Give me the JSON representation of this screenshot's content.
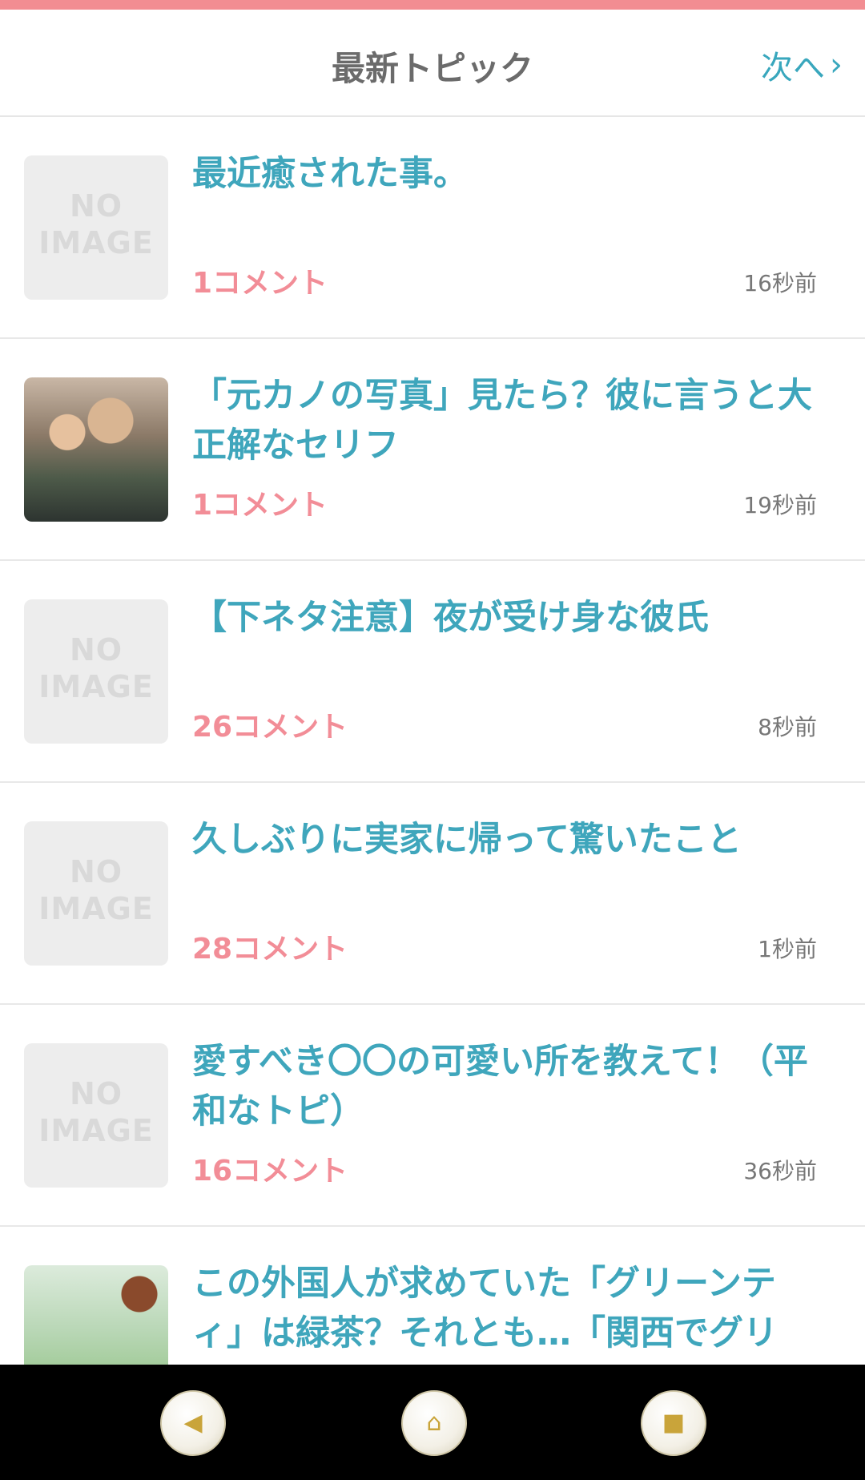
{
  "header": {
    "title": "最新トピック",
    "next_label": "次へ",
    "next_icon": "chevron-right-icon"
  },
  "topics": [
    {
      "title": "最近癒された事。",
      "comments": "1コメント",
      "time": "16秒前",
      "thumb": "NO IMAGE"
    },
    {
      "title": "「元カノの写真」見たら？彼に言うと大正解なセリフ",
      "comments": "1コメント",
      "time": "19秒前",
      "thumb": ""
    },
    {
      "title": "【下ネタ注意】夜が受け身な彼氏",
      "comments": "26コメント",
      "time": "8秒前",
      "thumb": "NO IMAGE"
    },
    {
      "title": "久しぶりに実家に帰って驚いたこと",
      "comments": "28コメント",
      "time": "1秒前",
      "thumb": "NO IMAGE"
    },
    {
      "title": "愛すべき〇〇の可愛い所を教えて！（平和なトピ）",
      "comments": "16コメント",
      "time": "36秒前",
      "thumb": "NO IMAGE"
    },
    {
      "title": "この外国人が求めていた「グリーンティ」は緑茶？それとも…「関西でグリ",
      "comments": "",
      "time": "",
      "thumb": ""
    }
  ],
  "navbar": {
    "back_icon": "back-triangle-icon",
    "home_icon": "home-icon",
    "recents_icon": "recents-square-icon"
  },
  "colors": {
    "accent": "#f28d92",
    "title": "#3fa6bc",
    "comments": "#f28d97"
  }
}
